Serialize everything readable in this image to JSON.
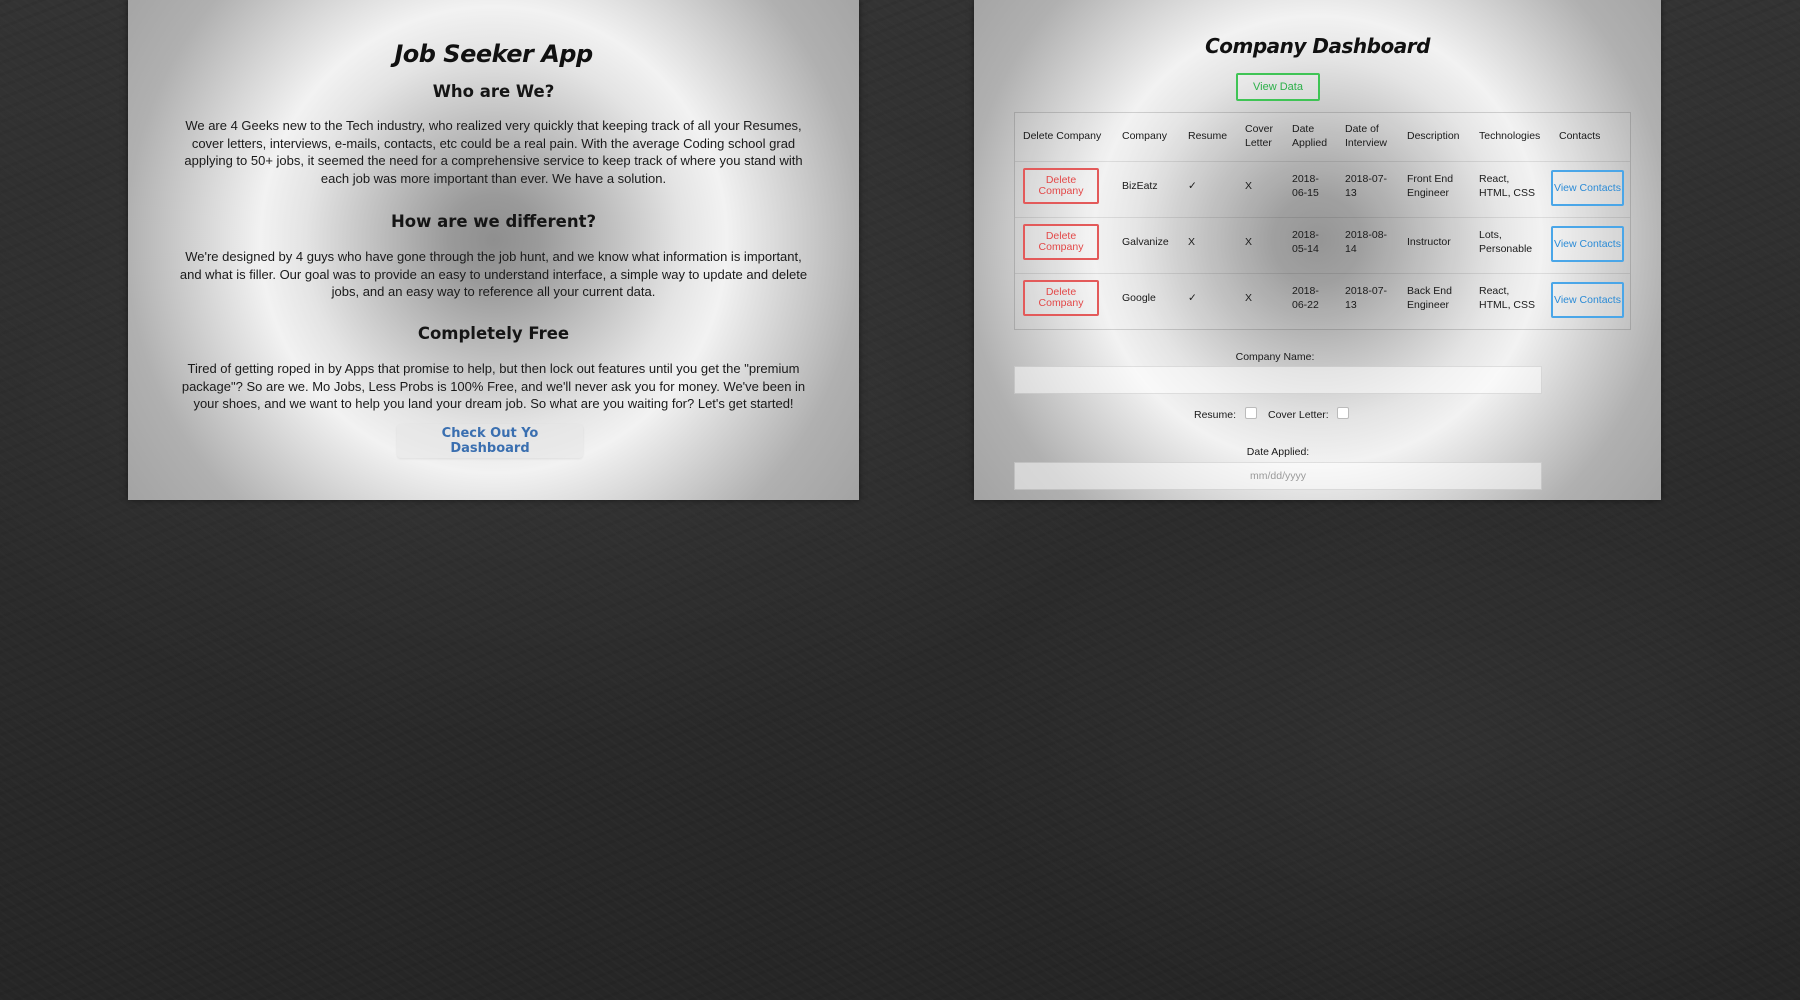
{
  "home": {
    "title": "Job Seeker App",
    "sections": [
      {
        "heading": "Who are We?",
        "text": "We are 4 Geeks new to the Tech industry, who realized very quickly that keeping track of all your Resumes, cover letters, interviews, e-mails, contacts, etc could be a real pain. With the average Coding school grad applying to 50+ jobs, it seemed the need for a comprehensive service to keep track of where you stand with each job was more important than ever. We have a solution."
      },
      {
        "heading": "How are we different?",
        "text": "We're designed by 4 guys who have gone through the job hunt, and we know what information is important, and what is filler. Our goal was to provide an easy to understand interface, a simple way to update and delete jobs, and an easy way to reference all your current data."
      },
      {
        "heading": "Completely Free",
        "text": "Tired of getting roped in by Apps that promise to help, but then lock out features until you get the \"premium package\"? So are we. Mo Jobs, Less Probs is 100% Free, and we'll never ask you for money. We've been in your shoes, and we want to help you land your dream job. So what are you waiting for? Let's get started!"
      }
    ],
    "cta_label": "Check Out Yo Dashboard"
  },
  "dashboard": {
    "title": "Company Dashboard",
    "view_data_label": "View Data",
    "columns": {
      "delete": "Delete Company",
      "company": "Company",
      "resume": "Resume",
      "cover_letter": "Cover Letter",
      "date_applied": "Date Applied",
      "date_interview": "Date of Interview",
      "description": "Description",
      "technologies": "Technologies",
      "contacts": "Contacts"
    },
    "rows": [
      {
        "delete_label": "Delete Company",
        "company": "BizEatz",
        "resume": "✓",
        "cover_letter": "X",
        "date_applied": "2018-06-15",
        "date_interview": "2018-07-13",
        "description": "Front End Engineer",
        "technologies": "React, HTML, CSS",
        "contacts_label": "View Contacts"
      },
      {
        "delete_label": "Delete Company",
        "company": "Galvanize",
        "resume": "X",
        "cover_letter": "X",
        "date_applied": "2018-05-14",
        "date_interview": "2018-08-14",
        "description": "Instructor",
        "technologies": "Lots, Personable",
        "contacts_label": "View Contacts"
      },
      {
        "delete_label": "Delete Company",
        "company": "Google",
        "resume": "✓",
        "cover_letter": "X",
        "date_applied": "2018-06-22",
        "date_interview": "2018-07-13",
        "description": "Back End Engineer",
        "technologies": "React, HTML, CSS",
        "contacts_label": "View Contacts"
      }
    ],
    "form": {
      "company_name_label": "Company Name:",
      "company_name_value": "",
      "resume_label": "Resume:",
      "cover_letter_label": "Cover Letter:",
      "date_applied_label": "Date Applied:",
      "date_applied_placeholder": "mm/dd/yyyy"
    }
  }
}
